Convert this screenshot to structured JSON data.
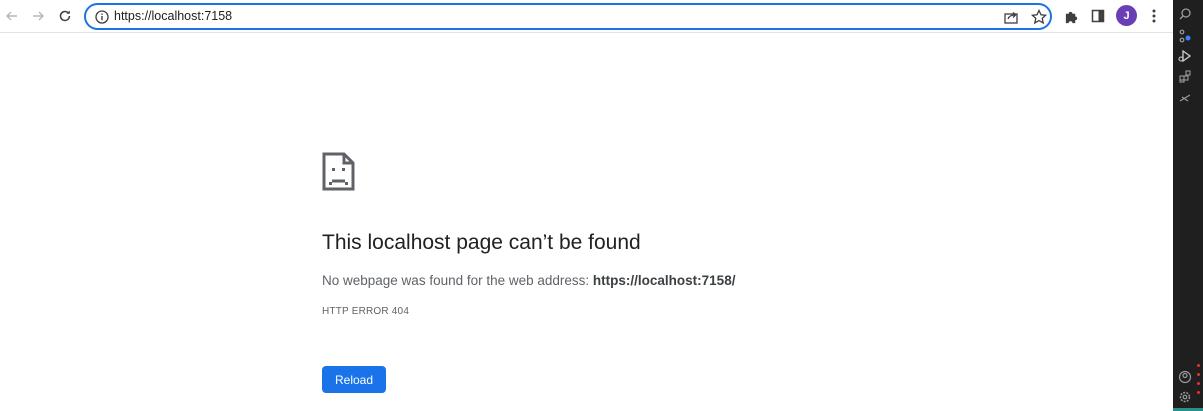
{
  "browser": {
    "url": "https://localhost:7158",
    "profile_initial": "J",
    "accent_color": "#1a73e8",
    "avatar_color": "#6a3fb5"
  },
  "icons": {
    "back": "arrow-left-icon",
    "forward": "arrow-right-icon",
    "reload": "reload-icon",
    "site_info": "info-icon",
    "share": "share-icon",
    "bookmark": "star-icon",
    "extensions": "puzzle-icon",
    "side_panel": "side-panel-icon",
    "menu": "kebab-menu-icon",
    "error_page": "sad-document-icon"
  },
  "error_page": {
    "title": "This localhost page can’t be found",
    "description_prefix": "No webpage was found for the web address: ",
    "description_url": "https://localhost:7158/",
    "error_code": "HTTP ERROR 404",
    "reload_label": "Reload"
  }
}
